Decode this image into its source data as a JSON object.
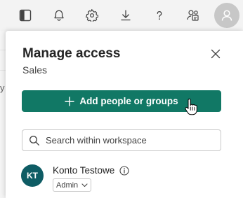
{
  "toolbar": {
    "icons": [
      "panel-toggle-icon",
      "bell-icon",
      "gear-icon",
      "download-icon",
      "help-icon",
      "share-people-icon",
      "account-avatar-icon"
    ]
  },
  "background": {
    "partial_letter": "y"
  },
  "panel": {
    "title": "Manage access",
    "subtitle": "Sales",
    "add_button_label": "Add people or groups",
    "search_placeholder": "Search within workspace",
    "accent_color": "#117865"
  },
  "users": [
    {
      "initials": "KT",
      "name": "Konto Testowe",
      "role": "Admin",
      "avatar_color": "#0e5c64"
    }
  ]
}
